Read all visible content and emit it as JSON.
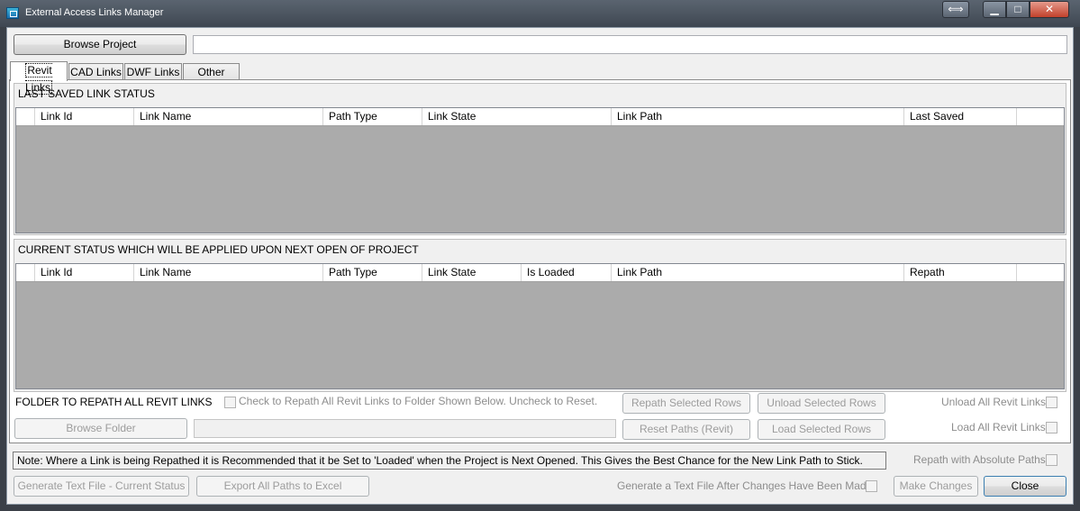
{
  "window": {
    "title": "External Access Links Manager",
    "resize_glyph": "⟺",
    "min_glyph": "▁",
    "max_glyph": "□",
    "close_glyph": "✕"
  },
  "browse_project": {
    "label": "Browse Project",
    "path_value": ""
  },
  "tabs": [
    {
      "label": "Revit Links",
      "active": true
    },
    {
      "label": "CAD Links",
      "active": false
    },
    {
      "label": "DWF Links",
      "active": false
    },
    {
      "label": "Other Links",
      "active": false
    }
  ],
  "last_saved": {
    "title": "LAST SAVED LINK STATUS",
    "columns": [
      "Link Id",
      "Link Name",
      "Path Type",
      "Link State",
      "Link Path",
      "Last Saved"
    ]
  },
  "current_status": {
    "title": "CURRENT STATUS WHICH WILL BE APPLIED UPON NEXT OPEN OF PROJECT",
    "columns": [
      "Link Id",
      "Link Name",
      "Path Type",
      "Link State",
      "Is Loaded",
      "Link Path",
      "Repath"
    ]
  },
  "repath": {
    "folder_label": "FOLDER TO REPATH ALL REVIT LINKS",
    "check_label": "Check to Repath All Revit Links to Folder Shown Below. Uncheck to Reset.",
    "browse_folder": "Browse Folder",
    "folder_value": "",
    "repath_selected": "Repath Selected Rows",
    "unload_selected": "Unload Selected Rows",
    "reset_paths": "Reset Paths (Revit)",
    "load_selected": "Load Selected Rows",
    "unload_all": "Unload All Revit Links",
    "load_all": "Load All Revit Links"
  },
  "note": "Note: Where a Link is being Repathed it is Recommended that it be Set to 'Loaded' when the Project is Next Opened. This Gives the Best Chance for the New Link Path to Stick.",
  "absolute_paths_label": "Repath with Absolute Paths",
  "footer": {
    "generate_current": "Generate Text File - Current Status",
    "export_excel": "Export All Paths to Excel",
    "generate_after": "Generate a Text File After Changes Have Been Made",
    "make_changes": "Make Changes",
    "close": "Close"
  }
}
